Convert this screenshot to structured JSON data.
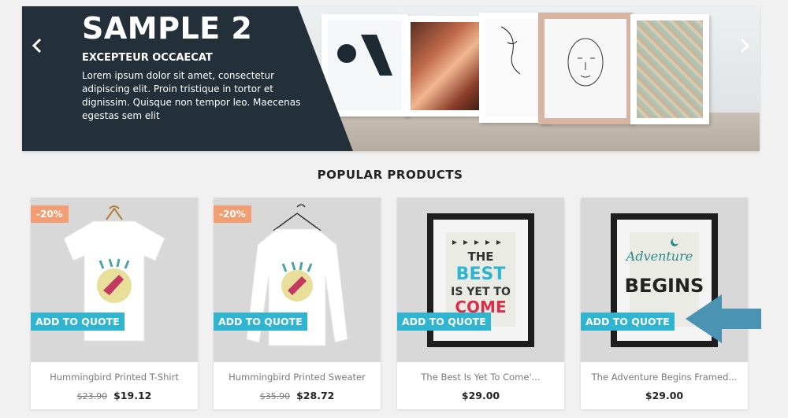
{
  "carousel": {
    "title": "SAMPLE 2",
    "subtitle": "EXCEPTEUR OCCAECAT",
    "text": "Lorem ipsum dolor sit amet, consectetur adipiscing elit. Proin tristique in tortor et dignissim. Quisque non tempor leo. Maecenas egestas sem elit",
    "prev_icon": "chevron-left-icon",
    "next_icon": "chevron-right-icon"
  },
  "section": {
    "title": "POPULAR PRODUCTS"
  },
  "products": [
    {
      "name": "Hummingbird Printed T-Shirt",
      "discount": "-20%",
      "old_price": "$23.90",
      "price": "$19.12",
      "button": "ADD TO QUOTE"
    },
    {
      "name": "Hummingbird Printed Sweater",
      "discount": "-20%",
      "old_price": "$35.90",
      "price": "$28.72",
      "button": "ADD TO QUOTE"
    },
    {
      "name": "The Best Is Yet To Come'...",
      "discount": "",
      "old_price": "",
      "price": "$29.00",
      "button": "ADD TO QUOTE"
    },
    {
      "name": "The Adventure Begins Framed...",
      "discount": "",
      "old_price": "",
      "price": "$29.00",
      "button": "ADD TO QUOTE"
    }
  ],
  "colors": {
    "accent": "#2fb5d2",
    "discount": "#f39d72",
    "overlay": "#233039",
    "pointer": "#4a93b3"
  }
}
